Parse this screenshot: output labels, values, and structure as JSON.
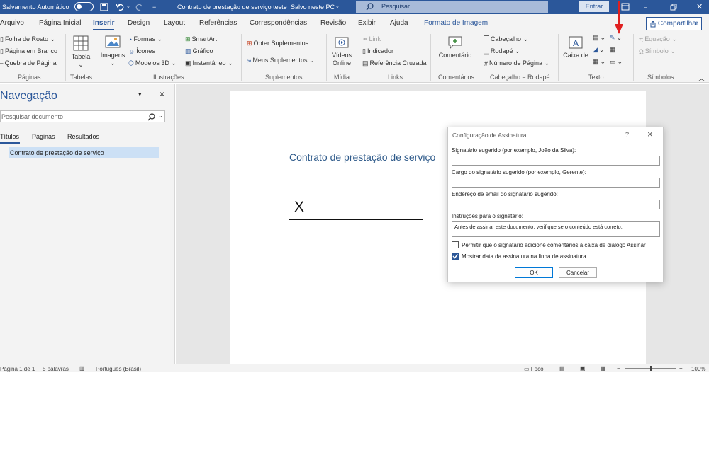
{
  "titlebar": {
    "autosave_label": "Salvamento Automático",
    "doc_title": "Contrato de prestação de serviço teste",
    "save_status": "Salvo neste PC",
    "search_placeholder": "Pesquisar",
    "signin_label": "Entrar"
  },
  "tabs": [
    "Arquivo",
    "Página Inicial",
    "Inserir",
    "Design",
    "Layout",
    "Referências",
    "Correspondências",
    "Revisão",
    "Exibir",
    "Ajuda",
    "Formato de Imagem"
  ],
  "active_tab": "Inserir",
  "share_label": "Compartilhar",
  "ribbon": {
    "paginas": {
      "folha_rosto": "Folha de Rosto",
      "pagina_branco": "Página em Branco",
      "quebra": "Quebra de Página",
      "group": "Páginas"
    },
    "tabelas": {
      "tabela": "Tabela",
      "group": "Tabelas"
    },
    "ilustracoes": {
      "imagens": "Imagens",
      "formas": "Formas",
      "icones": "Ícones",
      "modelos3d": "Modelos 3D",
      "smartart": "SmartArt",
      "grafico": "Gráfico",
      "instantaneo": "Instantâneo",
      "group": "Ilustrações"
    },
    "suplementos": {
      "obter": "Obter Suplementos",
      "meus": "Meus Suplementos",
      "group": "Suplementos"
    },
    "midia": {
      "videos": "Vídeos",
      "online": "Online",
      "group": "Mídia"
    },
    "links": {
      "link": "Link",
      "indicador": "Indicador",
      "ref_cruzada": "Referência Cruzada",
      "group": "Links"
    },
    "comentarios": {
      "comentario": "Comentário",
      "group": "Comentários"
    },
    "cabecalho": {
      "cabecalho": "Cabeçalho",
      "rodape": "Rodapé",
      "numero": "Número de Página",
      "group": "Cabeçalho e Rodapé"
    },
    "texto": {
      "caixa1": "Caixa de",
      "caixa2": "Texto",
      "group": "Texto"
    },
    "simbolos": {
      "equacao": "Equação",
      "simbolo": "Símbolo",
      "group": "Símbolos"
    }
  },
  "nav": {
    "title": "Navegação",
    "search_placeholder": "Pesquisar documento",
    "tabs": [
      "Títulos",
      "Páginas",
      "Resultados"
    ],
    "heading_item": "Contrato de prestação de serviço"
  },
  "document": {
    "heading": "Contrato de prestação de serviço",
    "signature_mark": "X"
  },
  "statusbar": {
    "page": "Página 1 de 1",
    "words": "5 palavras",
    "language": "Português (Brasil)",
    "focus": "Foco",
    "zoom": "100%"
  },
  "dialog": {
    "title": "Configuração de Assinatura",
    "help": "?",
    "close": "×",
    "signer_label": "Signatário sugerido (por exemplo, João da Silva):",
    "signer_value": "",
    "title_label": "Cargo do signatário sugerido (por exemplo, Gerente):",
    "title_value": "",
    "email_label": "Endereço de email do signatário sugerido:",
    "email_value": "",
    "instructions_label": "Instruções para o signatário:",
    "instructions_value": "Antes de assinar este documento, verifique se o conteúdo está correto.",
    "allow_comments_label": "Permitir que o signatário adicione comentários à caixa de diálogo Assinar",
    "allow_comments_checked": false,
    "show_date_label": "Mostrar data da assinatura na linha de assinatura",
    "show_date_checked": true,
    "ok_label": "OK",
    "cancel_label": "Cancelar"
  },
  "colors": {
    "accent": "#2b579a",
    "arrow": "#e02020",
    "checkbox": "#2b5797"
  }
}
